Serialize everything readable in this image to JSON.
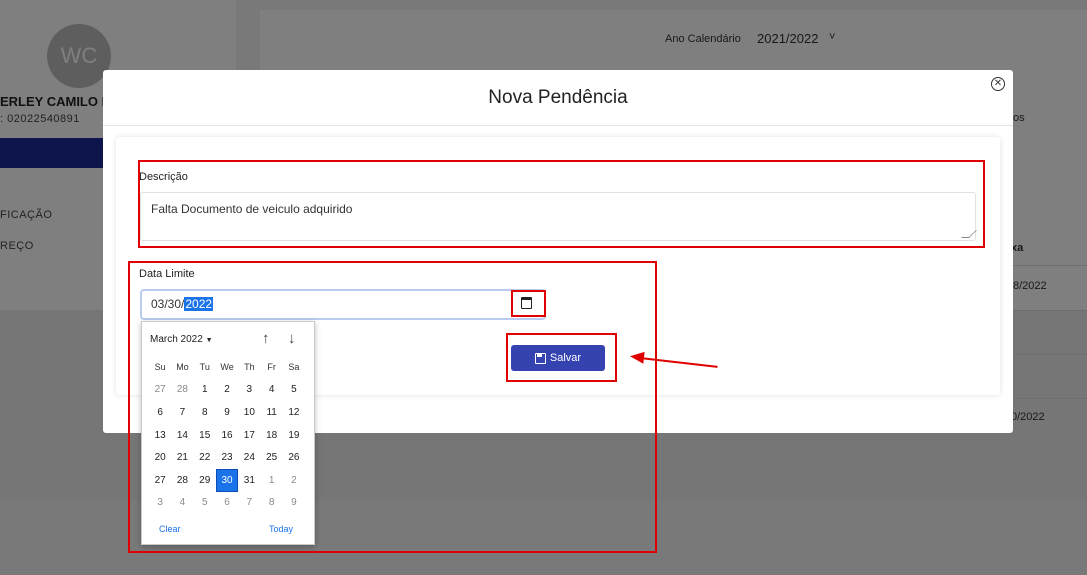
{
  "background": {
    "avatar_initials": "WC",
    "user_name": "ERLEY CAMILO D",
    "user_id": ": 02022540891",
    "sidebar_items": [
      "FICAÇÃO",
      "REÇO"
    ],
    "year_label": "Ano Calendário",
    "year_value": "2021/2022",
    "fragments": [
      "os",
      "xa",
      "8/2022",
      "0/2022"
    ]
  },
  "modal": {
    "title": "Nova Pendência",
    "descricao_label": "Descrição",
    "descricao_value": "Falta Documento de veiculo adquirido",
    "data_limite_label": "Data Limite",
    "date_prefix": "03/30/",
    "date_year": "2022",
    "save_label": "Salvar"
  },
  "calendar": {
    "month_label": "March 2022",
    "weekdays": [
      "Su",
      "Mo",
      "Tu",
      "We",
      "Th",
      "Fr",
      "Sa"
    ],
    "weeks": [
      [
        {
          "d": "27",
          "m": true
        },
        {
          "d": "28",
          "m": true
        },
        {
          "d": "1"
        },
        {
          "d": "2"
        },
        {
          "d": "3"
        },
        {
          "d": "4"
        },
        {
          "d": "5"
        }
      ],
      [
        {
          "d": "6"
        },
        {
          "d": "7"
        },
        {
          "d": "8"
        },
        {
          "d": "9"
        },
        {
          "d": "10"
        },
        {
          "d": "11"
        },
        {
          "d": "12"
        }
      ],
      [
        {
          "d": "13"
        },
        {
          "d": "14"
        },
        {
          "d": "15"
        },
        {
          "d": "16"
        },
        {
          "d": "17"
        },
        {
          "d": "18"
        },
        {
          "d": "19"
        }
      ],
      [
        {
          "d": "20"
        },
        {
          "d": "21"
        },
        {
          "d": "22"
        },
        {
          "d": "23"
        },
        {
          "d": "24"
        },
        {
          "d": "25"
        },
        {
          "d": "26"
        }
      ],
      [
        {
          "d": "27"
        },
        {
          "d": "28"
        },
        {
          "d": "29"
        },
        {
          "d": "30",
          "sel": true
        },
        {
          "d": "31"
        },
        {
          "d": "1",
          "m": true
        },
        {
          "d": "2",
          "m": true
        }
      ],
      [
        {
          "d": "3",
          "m": true
        },
        {
          "d": "4",
          "m": true
        },
        {
          "d": "5",
          "m": true
        },
        {
          "d": "6",
          "m": true
        },
        {
          "d": "7",
          "m": true
        },
        {
          "d": "8",
          "m": true
        },
        {
          "d": "9",
          "m": true
        }
      ]
    ],
    "clear_label": "Clear",
    "today_label": "Today"
  },
  "colors": {
    "accent": "#3443b0",
    "selection": "#1a73e8",
    "annotation": "#e00000"
  }
}
